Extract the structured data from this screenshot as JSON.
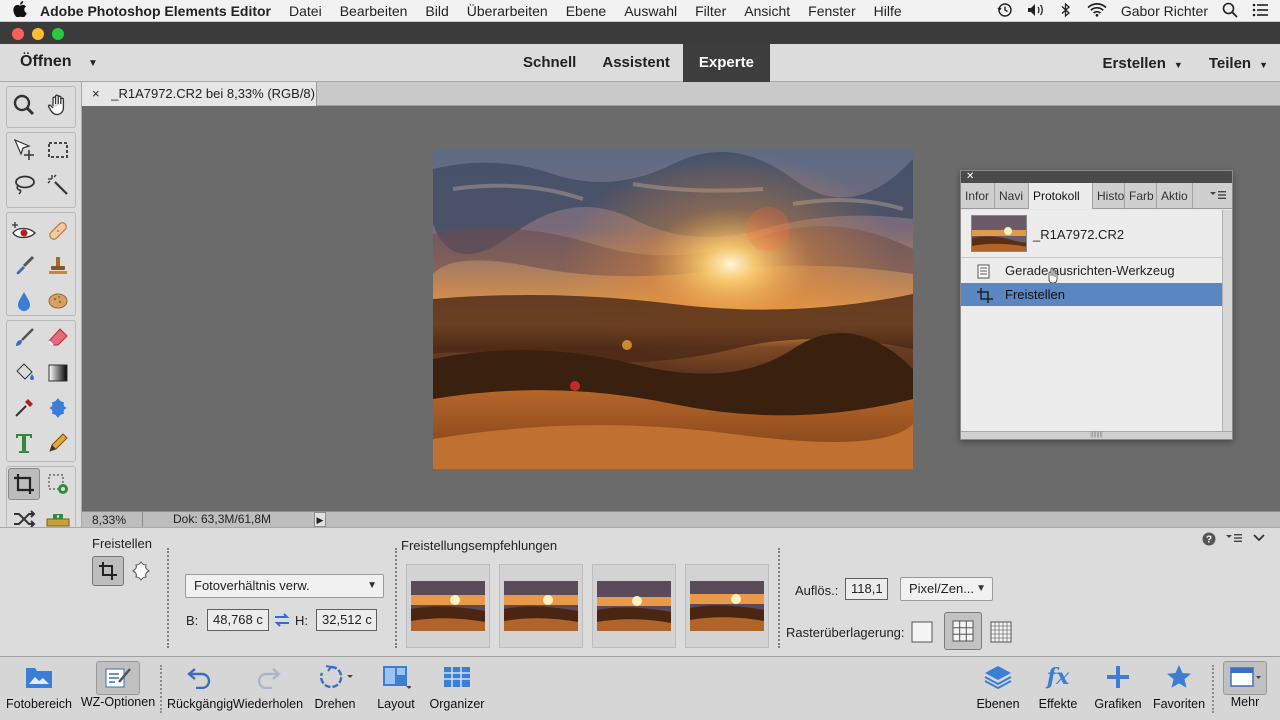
{
  "menubar": {
    "app_name": "Adobe Photoshop Elements Editor",
    "items": [
      "Datei",
      "Bearbeiten",
      "Bild",
      "Überarbeiten",
      "Ebene",
      "Auswahl",
      "Filter",
      "Ansicht",
      "Fenster",
      "Hilfe"
    ],
    "user": "Gabor Richter"
  },
  "modebar": {
    "open_label": "Öffnen",
    "modes": [
      "Schnell",
      "Assistent",
      "Experte"
    ],
    "active_mode": "Experte",
    "create_label": "Erstellen",
    "share_label": "Teilen"
  },
  "document": {
    "tab_title": "_R1A7972.CR2 bei 8,33% (RGB/8) *",
    "zoom": "8,33%",
    "doc_size": "Dok: 63,3M/61,8M"
  },
  "history_panel": {
    "tabs": [
      "Infor",
      "Navi",
      "Protokoll",
      "Histo",
      "Farb",
      "Aktio"
    ],
    "active_tab": "Protokoll",
    "snapshot_label": "_R1A7972.CR2",
    "steps": [
      "Gerade ausrichten-Werkzeug",
      "Freistellen"
    ],
    "selected_step": "Freistellen"
  },
  "tool_options": {
    "title": "Freistellen",
    "ratio_select": "Fotoverhältnis verw.",
    "width_label": "B:",
    "width_value": "48,768 c",
    "height_label": "H:",
    "height_value": "32,512 c",
    "recommendations_title": "Freistellungsempfehlungen",
    "resolution_label": "Auflös.:",
    "resolution_value": "118,1",
    "resolution_unit": "Pixel/Zen...",
    "grid_overlay_label": "Rasterüberlagerung:"
  },
  "taskbar": {
    "buttons": [
      "Fotobereich",
      "WZ-Optionen",
      "Rückgängig",
      "Wiederholen",
      "Drehen",
      "Layout",
      "Organizer",
      "Ebenen",
      "Effekte",
      "Grafiken",
      "Favoriten",
      "Mehr"
    ]
  },
  "colors": {
    "accent_selected": "#5a86c2",
    "mode_active_bg": "#3d3d3d",
    "foreground": "#000000",
    "background": "#ffffff"
  }
}
